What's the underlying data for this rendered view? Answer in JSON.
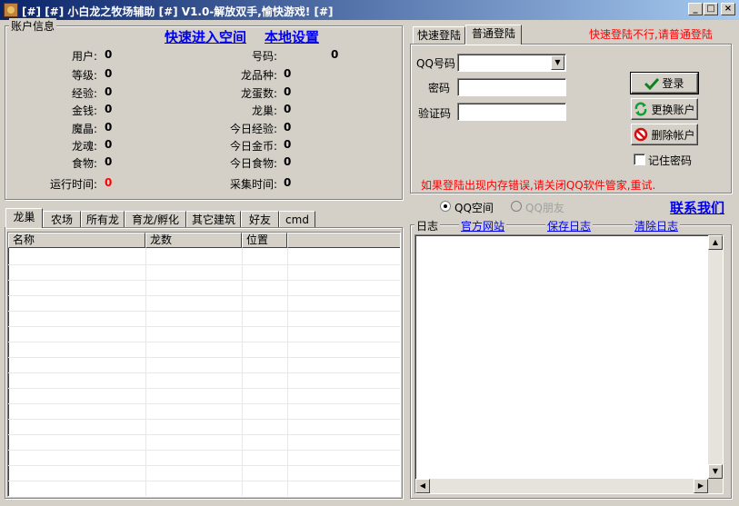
{
  "window": {
    "title": "[#] [#] 小白龙之牧场辅助 [#] V1.0-解放双手,愉快游戏! [#]",
    "btn_min": "_",
    "btn_max": "□",
    "btn_close": "×"
  },
  "account": {
    "legend": "账户信息",
    "quick_enter": "快速进入空间",
    "local_settings": "本地设置",
    "left": [
      {
        "label": "用户:",
        "value": "0"
      },
      {
        "label": "等级:",
        "value": "0"
      },
      {
        "label": "经验:",
        "value": "0"
      },
      {
        "label": "金钱:",
        "value": "0"
      },
      {
        "label": "魔晶:",
        "value": "0"
      },
      {
        "label": "龙魂:",
        "value": "0"
      },
      {
        "label": "食物:",
        "value": "0"
      },
      {
        "label": "运行时间:",
        "value": "0"
      }
    ],
    "right": [
      {
        "label": "号码:",
        "value": "0"
      },
      {
        "label": "龙品种:",
        "value": "0"
      },
      {
        "label": "龙蛋数:",
        "value": "0"
      },
      {
        "label": "龙巢:",
        "value": "0"
      },
      {
        "label": "今日经验:",
        "value": "0"
      },
      {
        "label": "今日金币:",
        "value": "0"
      },
      {
        "label": "今日食物:",
        "value": "0"
      },
      {
        "label": "采集时间:",
        "value": "0"
      }
    ]
  },
  "login": {
    "tabs": [
      "快速登陆",
      "普通登陆"
    ],
    "active_tab": 1,
    "hint": "快速登陆不行,请普通登陆",
    "qq_label": "QQ号码",
    "qq_value": "",
    "pwd_label": "密码",
    "code_label": "验证码",
    "login_btn": "登录",
    "change_btn": "更换账户",
    "delete_btn": "删除帐户",
    "remember": "记住密码",
    "error_hint": "如果登陆出现内存错误,请关闭QQ软件管家,重试."
  },
  "mode": {
    "opt1": "QQ空间",
    "opt2": "QQ朋友",
    "contact": "联系我们"
  },
  "dragon_tabs": [
    "龙巢",
    "农场",
    "所有龙",
    "育龙/孵化",
    "其它建筑",
    "好友",
    "cmd"
  ],
  "table": {
    "headers": [
      "名称",
      "龙数",
      "位置"
    ]
  },
  "log": {
    "legend": "日志",
    "official": "官方网站",
    "save": "保存日志",
    "clear": "清除日志"
  },
  "colors": {
    "face": "#d4d0c8",
    "title_start": "#0a246a",
    "title_end": "#a6caf0",
    "link": "#0000ee",
    "warn": "#ff0000"
  }
}
